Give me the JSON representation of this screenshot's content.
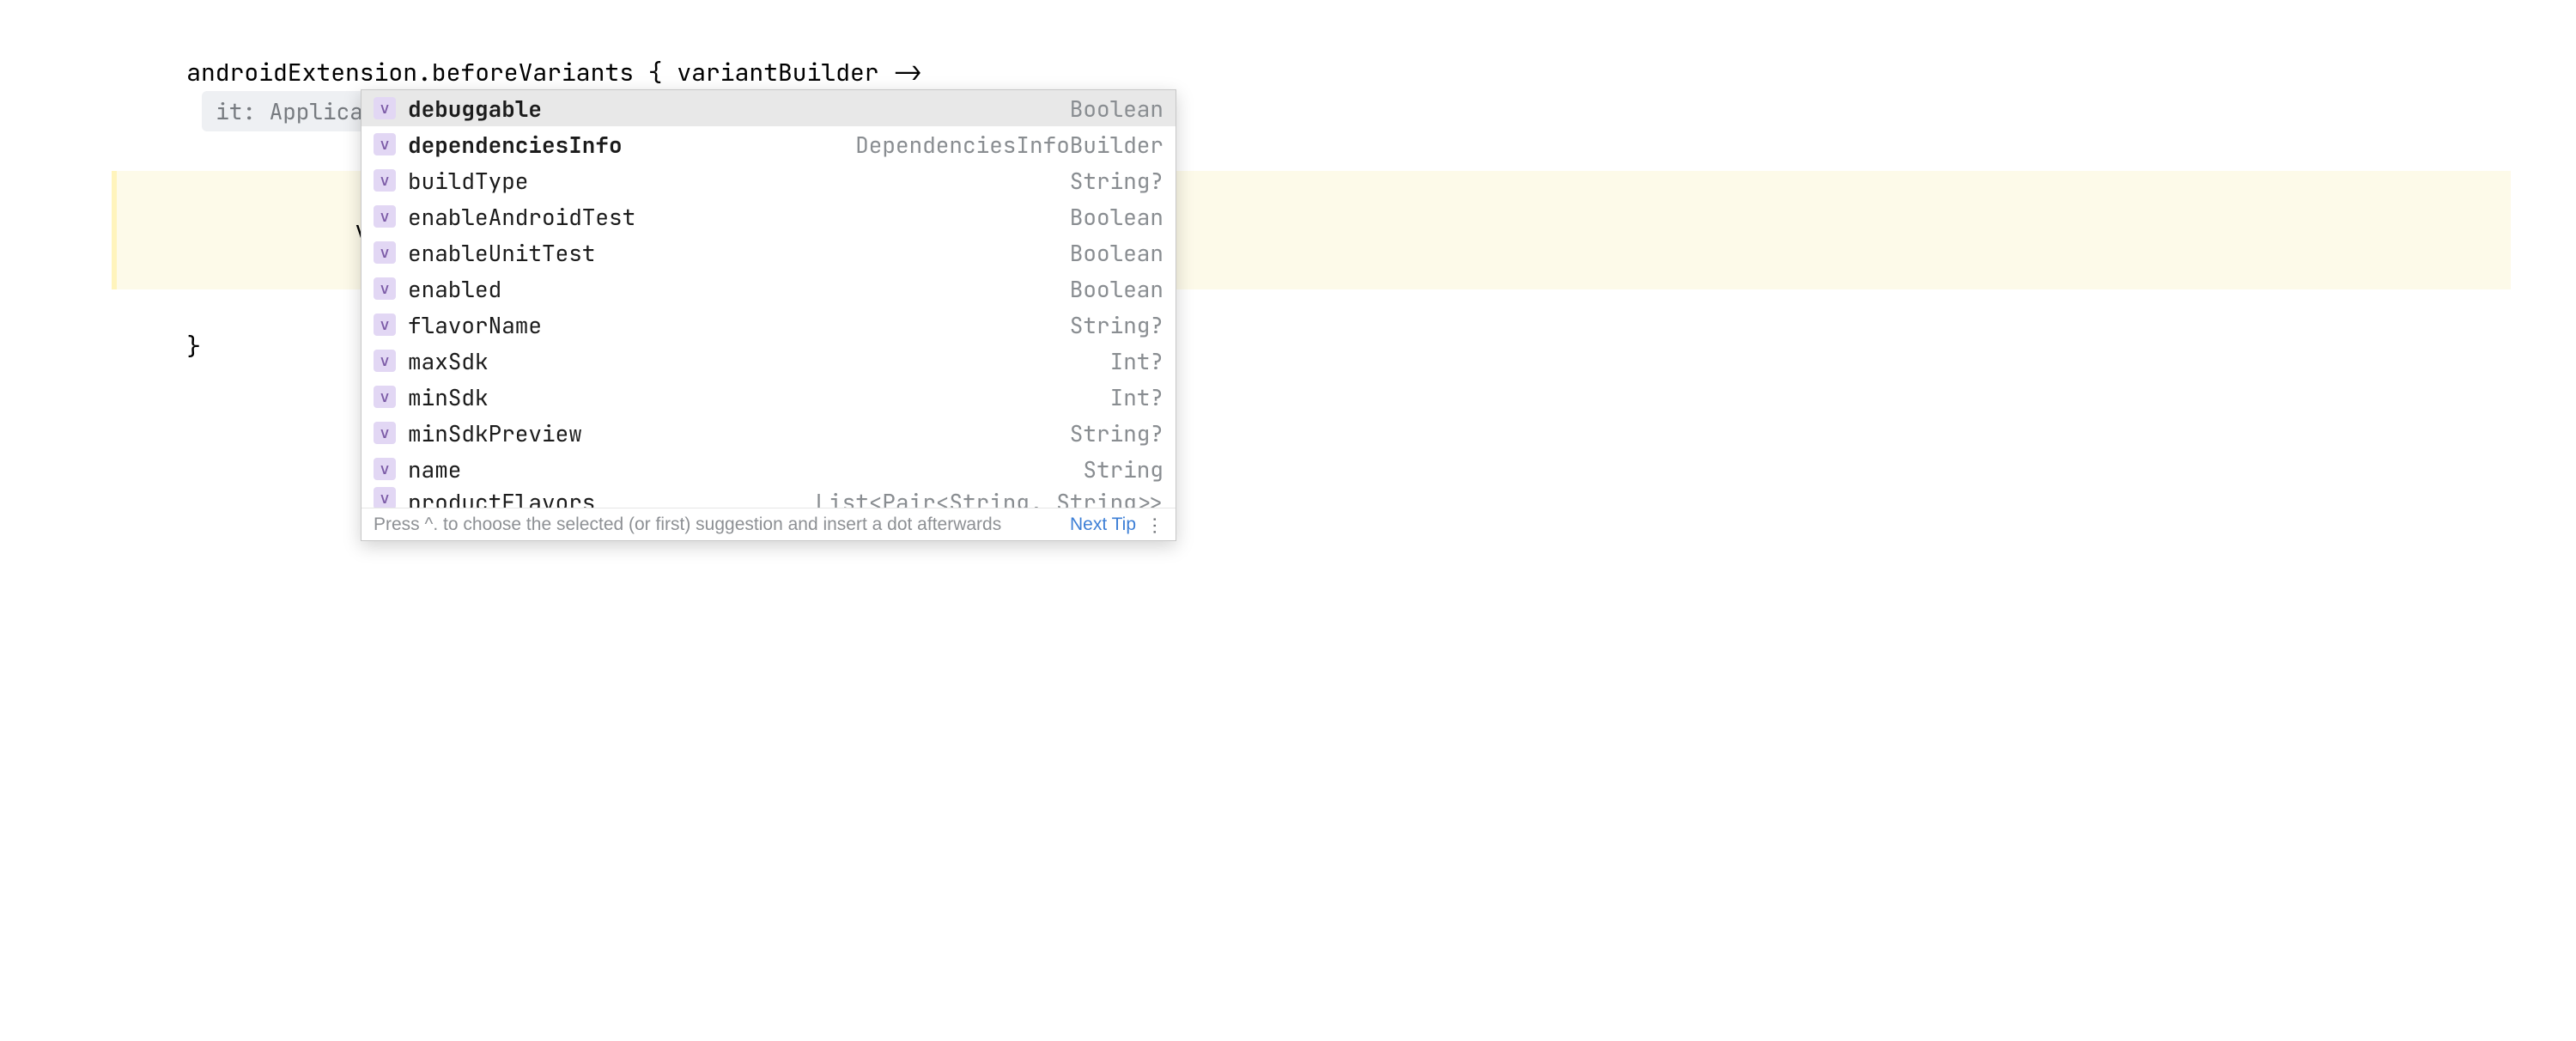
{
  "editor": {
    "line1_pre": "androidExtension.beforeVariants { variantBuilder ->",
    "hint_label": "it: ApplicationVariantBuilder",
    "line2": "variantBuilder.",
    "line3": "}"
  },
  "popup": {
    "icon_letter": "v",
    "items": [
      {
        "name": "debuggable",
        "type": "Boolean",
        "bold": true,
        "selected": true
      },
      {
        "name": "dependenciesInfo",
        "type": "DependenciesInfoBuilder",
        "bold": true,
        "selected": false
      },
      {
        "name": "buildType",
        "type": "String?",
        "bold": false,
        "selected": false
      },
      {
        "name": "enableAndroidTest",
        "type": "Boolean",
        "bold": false,
        "selected": false
      },
      {
        "name": "enableUnitTest",
        "type": "Boolean",
        "bold": false,
        "selected": false
      },
      {
        "name": "enabled",
        "type": "Boolean",
        "bold": false,
        "selected": false
      },
      {
        "name": "flavorName",
        "type": "String?",
        "bold": false,
        "selected": false
      },
      {
        "name": "maxSdk",
        "type": "Int?",
        "bold": false,
        "selected": false
      },
      {
        "name": "minSdk",
        "type": "Int?",
        "bold": false,
        "selected": false
      },
      {
        "name": "minSdkPreview",
        "type": "String?",
        "bold": false,
        "selected": false
      },
      {
        "name": "name",
        "type": "String",
        "bold": false,
        "selected": false
      },
      {
        "name": "productFlavors",
        "type": "List<Pair<String, String>>",
        "bold": false,
        "selected": false,
        "cutoff": true
      }
    ],
    "footer_hint": "Press ^. to choose the selected (or first) suggestion and insert a dot afterwards",
    "next_tip": "Next Tip"
  }
}
